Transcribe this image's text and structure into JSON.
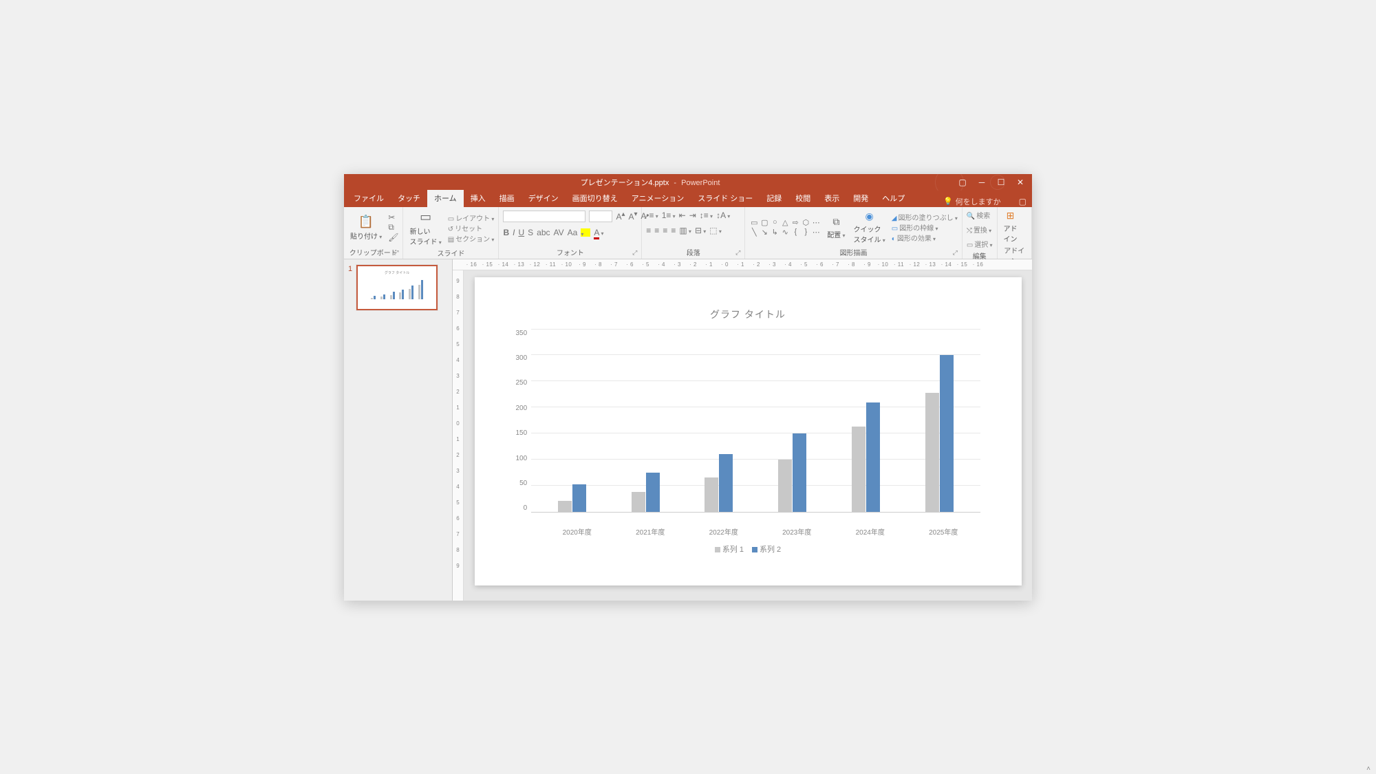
{
  "titlebar": {
    "document": "プレゼンテーション4.pptx",
    "separator": "-",
    "app": "PowerPoint"
  },
  "tabs": {
    "file": "ファイル",
    "touch": "タッチ",
    "home": "ホーム",
    "insert": "挿入",
    "draw": "描画",
    "design": "デザイン",
    "transitions": "画面切り替え",
    "animations": "アニメーション",
    "slideshow": "スライド ショー",
    "record": "記録",
    "review": "校閲",
    "view": "表示",
    "developer": "開発",
    "help": "ヘルプ",
    "tellme": "何をしますか"
  },
  "ribbon": {
    "clipboard": {
      "label": "クリップボード",
      "paste": "貼り付け"
    },
    "slides": {
      "label": "スライド",
      "new": "新しい\nスライド",
      "layout": "レイアウト",
      "reset": "リセット",
      "section": "セクション"
    },
    "font": {
      "label": "フォント"
    },
    "paragraph": {
      "label": "段落"
    },
    "drawing": {
      "label": "図形描画",
      "arrange": "配置",
      "quickstyles": "クイック\nスタイル",
      "fill": "図形の塗りつぶし",
      "outline": "図形の枠線",
      "effects": "図形の効果"
    },
    "editing": {
      "label": "編集",
      "find": "検索",
      "replace": "置換",
      "select": "選択"
    },
    "addins": {
      "label": "アドイン",
      "btn": "アド\nイン"
    }
  },
  "slides_panel": {
    "num": "1"
  },
  "ruler_h": [
    "16",
    "15",
    "14",
    "13",
    "12",
    "11",
    "10",
    "9",
    "8",
    "7",
    "6",
    "5",
    "4",
    "3",
    "2",
    "1",
    "0",
    "1",
    "2",
    "3",
    "4",
    "5",
    "6",
    "7",
    "8",
    "9",
    "10",
    "11",
    "12",
    "13",
    "14",
    "15",
    "16"
  ],
  "ruler_v": [
    "9",
    "8",
    "7",
    "6",
    "5",
    "4",
    "3",
    "2",
    "1",
    "0",
    "1",
    "2",
    "3",
    "4",
    "5",
    "6",
    "7",
    "8",
    "9"
  ],
  "chart_data": {
    "type": "bar",
    "title": "グラフ タイトル",
    "categories": [
      "2020年度",
      "2021年度",
      "2022年度",
      "2023年度",
      "2024年度",
      "2025年度"
    ],
    "series": [
      {
        "name": "系列 1",
        "values": [
          20,
          38,
          65,
          100,
          163,
          228
        ],
        "color": "#c8c8c8"
      },
      {
        "name": "系列 2",
        "values": [
          52,
          75,
          110,
          150,
          210,
          300
        ],
        "color": "#5b8bbf"
      }
    ],
    "ylim": [
      0,
      350
    ],
    "yticks": [
      0,
      50,
      100,
      150,
      200,
      250,
      300,
      350
    ],
    "xlabel": "",
    "ylabel": ""
  }
}
